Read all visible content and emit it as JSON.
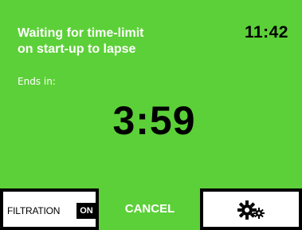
{
  "screen": {
    "status_message": "Waiting for time-limit\non start-up to lapse",
    "clock": "11:42",
    "ends_label": "Ends in:",
    "countdown": "3:59"
  },
  "bottom_bar": {
    "filtration_label": "FILTRATION",
    "filtration_state": "ON",
    "cancel_label": "CANCEL",
    "settings_icon": "settings-gears-icon"
  },
  "colors": {
    "background": "#5cd038",
    "text_primary": "#ffffff",
    "text_secondary": "#000000",
    "button_background": "#ffffff",
    "button_border": "#000000"
  }
}
